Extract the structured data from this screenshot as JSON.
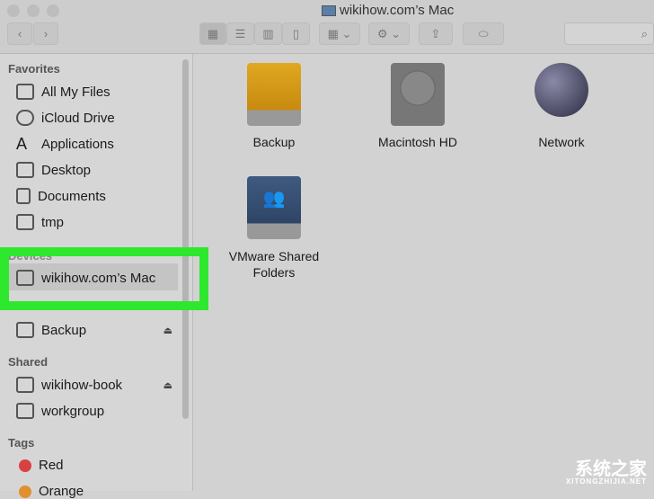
{
  "window": {
    "title": "wikihow.com’s Mac"
  },
  "toolbar": {
    "back": "‹",
    "forward": "›",
    "search_icon": "⌕"
  },
  "sidebar": {
    "favorites_label": "Favorites",
    "favorites": [
      {
        "label": "All My Files"
      },
      {
        "label": "iCloud Drive"
      },
      {
        "label": "Applications"
      },
      {
        "label": "Desktop"
      },
      {
        "label": "Documents"
      },
      {
        "label": "tmp"
      }
    ],
    "devices_label": "Devices",
    "devices": [
      {
        "label": "wikihow.com’s Mac"
      },
      {
        "label": "Backup"
      }
    ],
    "shared_label": "Shared",
    "shared": [
      {
        "label": "wikihow-book"
      },
      {
        "label": "workgroup"
      }
    ],
    "tags_label": "Tags",
    "tags": [
      {
        "label": "Red",
        "color": "#d94040"
      },
      {
        "label": "Orange",
        "color": "#e09030"
      }
    ]
  },
  "main": {
    "items": [
      {
        "label": "Backup"
      },
      {
        "label": "Macintosh HD"
      },
      {
        "label": "Network"
      },
      {
        "label": "VMware Shared Folders"
      }
    ]
  },
  "highlight_color": "#2ee82e",
  "watermark": {
    "text": "系统之家",
    "sub": "XITONGZHIJIA.NET"
  }
}
